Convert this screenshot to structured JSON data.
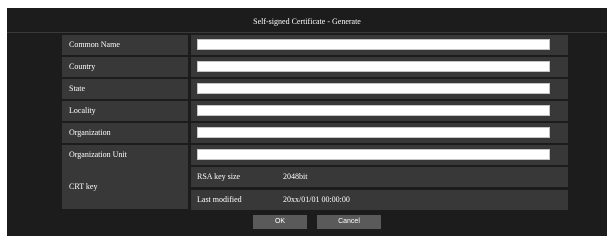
{
  "dialog": {
    "title": "Self-signed Certificate - Generate"
  },
  "fields": [
    {
      "label": "Common Name",
      "value": ""
    },
    {
      "label": "Country",
      "value": ""
    },
    {
      "label": "State",
      "value": ""
    },
    {
      "label": "Locality",
      "value": ""
    },
    {
      "label": "Organization",
      "value": ""
    },
    {
      "label": "Organization Unit",
      "value": ""
    }
  ],
  "crt": {
    "label": "CRT key",
    "rsa_label": "RSA key size",
    "rsa_value": "2048bit",
    "modified_label": "Last modified",
    "modified_value": "20xx/01/01 00:00:00"
  },
  "buttons": {
    "ok": "OK",
    "cancel": "Cancel"
  }
}
